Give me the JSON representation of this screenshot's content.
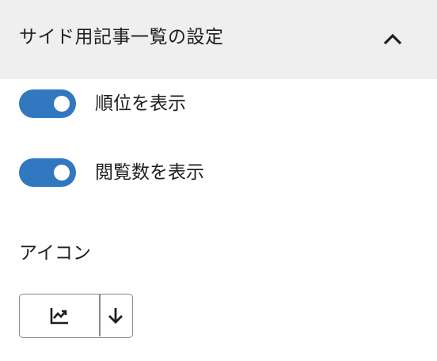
{
  "panel": {
    "title": "サイド用記事一覧の設定",
    "expanded": true,
    "collapse_icon": "chevron-up-icon"
  },
  "toggles": [
    {
      "label": "順位を表示",
      "checked": true
    },
    {
      "label": "閲覧数を表示",
      "checked": true
    }
  ],
  "icon_setting": {
    "label": "アイコン",
    "selected_icon": "trending-up-chart-icon",
    "dropdown_icon": "arrow-down-icon"
  },
  "colors": {
    "toggle_on": "#3178c0",
    "header_bg": "#efefef",
    "text": "#1e1e1e",
    "border": "#8a8a8a"
  }
}
